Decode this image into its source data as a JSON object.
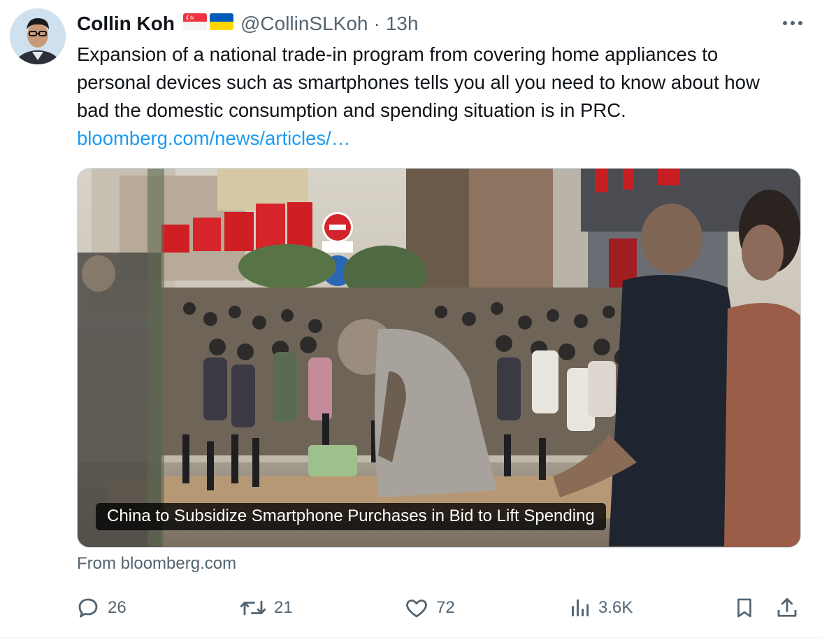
{
  "tweet": {
    "author_name": "Collin Koh",
    "flags": [
      "singapore-flag-icon",
      "ukraine-flag-icon"
    ],
    "handle": "@CollinSLKoh",
    "separator": "·",
    "time": "13h",
    "text": "Expansion of a national trade-in program from covering home appliances to personal devices such as smartphones tells you all you need to know about how bad the domestic consumption and spending situation is in PRC.",
    "link": "bloomberg.com/news/articles/…"
  },
  "card": {
    "headline": "China to Subsidize Smartphone Purchases in Bid to Lift Spending",
    "source": "From bloomberg.com"
  },
  "actions": {
    "replies": "26",
    "reposts": "21",
    "likes": "72",
    "views": "3.6K"
  },
  "colors": {
    "accent": "#1d9bf0",
    "secondary_text": "#536471",
    "primary_text": "#0f1419"
  }
}
